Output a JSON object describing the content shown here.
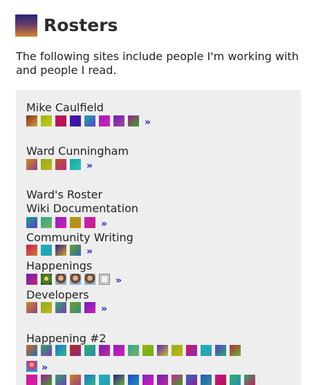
{
  "header": {
    "title": "Rosters"
  },
  "intro": "The following sites include people I'm working with and people I read.",
  "more_glyph": "»",
  "rosters": [
    {
      "label": "Mike Caulfield",
      "flags": [
        [
          "#8a2a2a",
          "#d1a22e"
        ],
        [
          "#96b40c",
          "#c8cd20"
        ],
        [
          "#c01760",
          "#b4124a"
        ],
        [
          "#4316b8",
          "#3a1895"
        ],
        [
          "#18b0a0",
          "#5a3dd0"
        ],
        [
          "#9b1fc3",
          "#d81fb2"
        ],
        [
          "#6a1fbc",
          "#a34a8c"
        ],
        [
          "#9a1a9e",
          "#3ea31f"
        ]
      ],
      "more": true
    },
    {
      "label": "Ward Cunningham",
      "flags": [
        [
          "#c98a1c",
          "#9a3d8a"
        ],
        [
          "#8ab114",
          "#cdb31c"
        ],
        [
          "#b45a1f",
          "#c02a8d"
        ],
        [
          "#13a8a6",
          "#2bc8b6"
        ]
      ],
      "more": true
    },
    {
      "label": "Ward's Roster",
      "flags": [],
      "more": false
    },
    {
      "label": "Wiki Documentation",
      "flags": [
        [
          "#18a08a",
          "#5a3dd0"
        ],
        [
          "#2aa88a",
          "#7bb06a"
        ],
        [
          "#8a1fc3",
          "#d51fb2"
        ],
        [
          "#9a9b14",
          "#d1871c"
        ],
        [
          "#b42ab4",
          "#d8188a"
        ]
      ],
      "more": true
    },
    {
      "label": "Community Writing",
      "flags": [
        [
          "#c81a5a",
          "#d17b2a"
        ],
        [
          "#1ab0c0",
          "#2ba0a8"
        ],
        [
          "#2a1f8c",
          "#d8a12a"
        ],
        [
          "#6aa21f",
          "#2a6ab4"
        ]
      ],
      "more": true
    },
    {
      "label": "Happenings",
      "flags": [
        [
          "#6a1fbc",
          "#c02a6a"
        ]
      ],
      "faces": [
        "tree-face-icon",
        "person-face-icon",
        "person-face-icon",
        "person-face-icon",
        "sticker-face-icon"
      ],
      "more": true
    },
    {
      "label": "Developers",
      "flags": [
        [
          "#c98a1c",
          "#9a3d8a"
        ],
        [
          "#8ab114",
          "#cdb31c"
        ],
        [
          "#2aa86a",
          "#7a3ab4"
        ],
        [
          "#6aa21f",
          "#3a8a8a"
        ],
        [
          "#6a1fbc",
          "#d11fb2"
        ]
      ],
      "more": true
    },
    {
      "label": "Happening #2",
      "flags": [
        [
          "#c86a1c",
          "#2a6ab4"
        ],
        [
          "#2aa86a",
          "#7a3ab4"
        ],
        [
          "#1a7ac8",
          "#3ab48a"
        ],
        [
          "#b42a1c",
          "#8a2a8a"
        ],
        [
          "#2ab46a",
          "#2a8ab4"
        ],
        [
          "#7a1fbc",
          "#c02a9a"
        ],
        [
          "#8a1fc3",
          "#d51fb2"
        ],
        [
          "#2aa88a",
          "#7bb06a"
        ],
        [
          "#9ab114",
          "#6ab41c"
        ],
        [
          "#6a1fbc",
          "#c0c02a"
        ],
        [
          "#8ab114",
          "#cdb31c"
        ],
        [
          "#c81a5a",
          "#8a2ab4"
        ],
        [
          "#1ab0c0",
          "#2ba0a8"
        ],
        [
          "#5a3dd0",
          "#2aa86a"
        ],
        [
          "#b42a3a",
          "#6ab43a"
        ]
      ],
      "flags_row2": [],
      "more": true
    },
    {
      "label": "",
      "flags": [
        [
          "#c8188a",
          "#d81fb2"
        ],
        [
          "#9a1a9e",
          "#3ea31f"
        ],
        [
          "#2aa86a",
          "#7a3ab4"
        ],
        [
          "#c98a1c",
          "#9a3d8a"
        ],
        [
          "#1a7ac8",
          "#3ab48a"
        ],
        [
          "#1ab0c0",
          "#2ba0a8"
        ],
        [
          "#2a1f8c",
          "#6ab43a"
        ],
        [
          "#1a4ac8",
          "#2a8ab4"
        ],
        [
          "#8a1fc3",
          "#d51fb2"
        ],
        [
          "#6a1fbc",
          "#c02a9a"
        ],
        [
          "#c02a9a",
          "#3ea31f"
        ],
        [
          "#2a6ab4",
          "#9a1a9e"
        ],
        [
          "#1a5ac8",
          "#3a8a8a"
        ],
        [
          "#c8188a",
          "#b4124a"
        ],
        [
          "#2ab46a",
          "#2a8ab4"
        ],
        [
          "#2aa86a",
          "#c81a5a"
        ]
      ],
      "more": false
    }
  ]
}
